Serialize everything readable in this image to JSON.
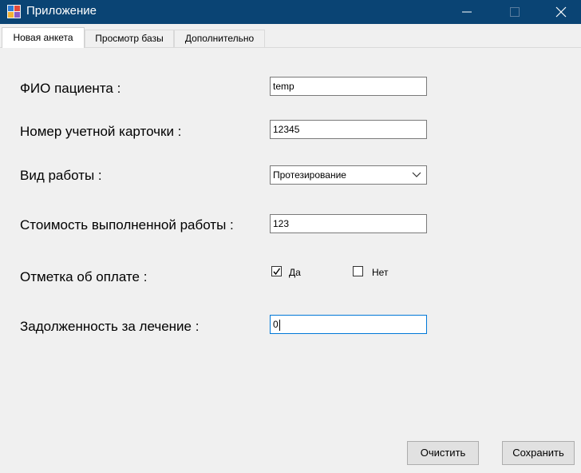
{
  "window": {
    "title": "Приложение",
    "icons": {
      "app": "app-icon",
      "minimize": "minimize-icon",
      "maximize": "maximize-icon",
      "close": "close-icon"
    }
  },
  "tabs": [
    {
      "label": "Новая анкета",
      "active": true
    },
    {
      "label": "Просмотр базы",
      "active": false
    },
    {
      "label": "Дополнительно",
      "active": false
    }
  ],
  "form": {
    "patient_label": "ФИО пациента :",
    "patient_value": "temp",
    "card_label": "Номер учетной карточки :",
    "card_value": "12345",
    "work_type_label": "Вид работы :",
    "work_type_value": "Протезирование",
    "cost_label": "Стоимость выполненной работы :",
    "cost_value": "123",
    "payment_label": "Отметка об оплате :",
    "payment_yes_label": "Да",
    "payment_yes_checked": true,
    "payment_no_label": "Нет",
    "payment_no_checked": false,
    "debt_label": "Задолженность за лечение :",
    "debt_value": "0"
  },
  "buttons": {
    "clear_label": "Очистить",
    "save_label": "Сохранить"
  },
  "colors": {
    "titlebar": "#0a4474",
    "focus_border": "#0078d7"
  }
}
